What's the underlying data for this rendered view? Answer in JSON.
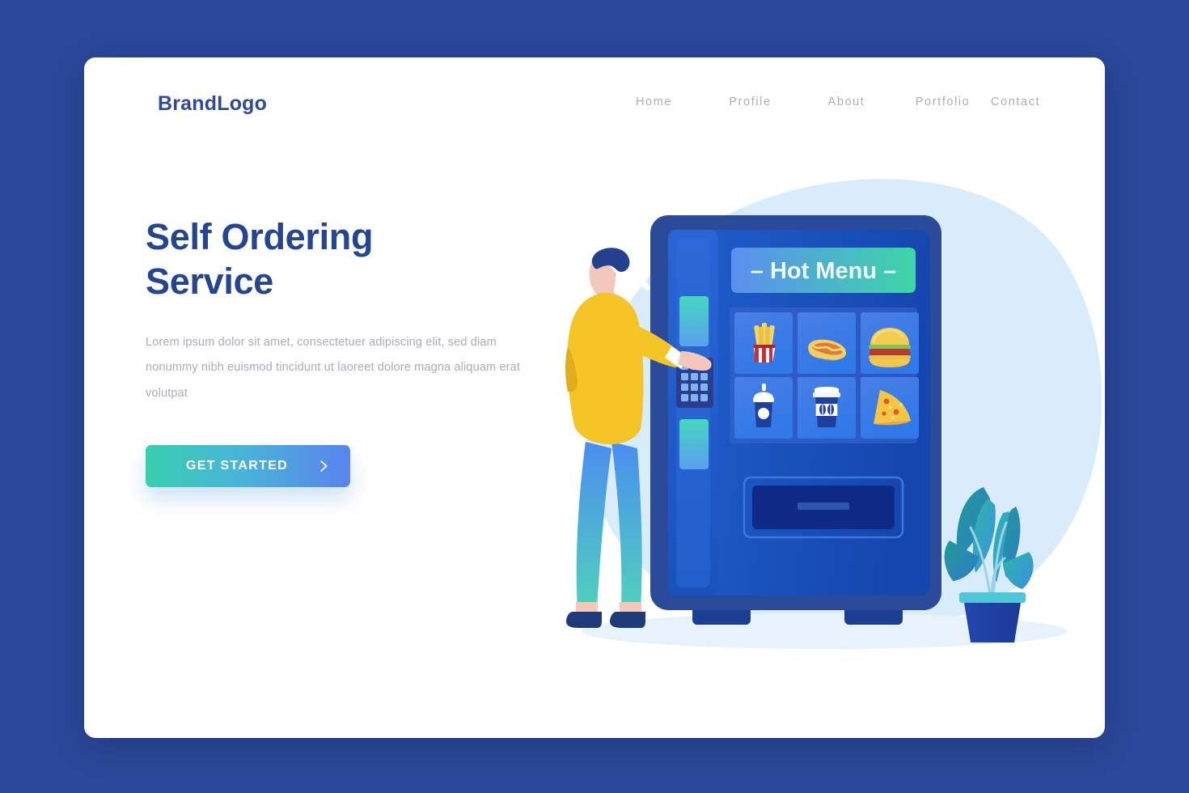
{
  "page": {
    "background_color": "#2a4799",
    "card_background": "#ffffff"
  },
  "header": {
    "brand": "BrandLogo",
    "brand_color": "#2c4a9a",
    "nav": [
      {
        "label": "Home"
      },
      {
        "label": "Profile"
      },
      {
        "label": "About"
      },
      {
        "label": "Portfolio"
      },
      {
        "label": "Contact"
      }
    ]
  },
  "hero": {
    "title_line1": "Self Ordering",
    "title_line2": "Service",
    "title_color": "#24458f",
    "description": "Lorem ipsum dolor sit amet, consectetuer adipiscing elit, sed diam nonummy nibh euismod tincidunt ut laoreet dolore magna aliquam erat volutpat",
    "cta_label": "GET STARTED",
    "cta_icon": "chevron-right-icon",
    "cta_gradient_from": "#38cfae",
    "cta_gradient_to": "#5a83ee"
  },
  "illustration": {
    "name": "self-ordering-vending-machine-illustration",
    "blob_color": "#d9ecfb",
    "cutlery_icon": "spoon-fork-crossed-icon",
    "vending_machine": {
      "body_color": "#1b56c4",
      "frame_color": "#2c4a9a",
      "screen_banner": {
        "label": "– Hot Menu –",
        "gradient_from": "#5b8ef0",
        "gradient_to": "#3dd6a8"
      },
      "menu_items": [
        {
          "name": "french-fries-icon",
          "label": "French Fries"
        },
        {
          "name": "hot-dog-icon",
          "label": "Hot Dog"
        },
        {
          "name": "burger-icon",
          "label": "Burger"
        },
        {
          "name": "smoothie-cup-icon",
          "label": "Smoothie"
        },
        {
          "name": "coffee-cup-icon",
          "label": "Coffee"
        },
        {
          "name": "pizza-slice-icon",
          "label": "Pizza Slice"
        }
      ],
      "keypad": {
        "name": "keypad",
        "rows": 4,
        "cols": 3
      },
      "dispenser_slot": {
        "name": "dispenser-slot"
      }
    },
    "person": {
      "name": "person-using-vending-machine",
      "hair_color": "#24418f",
      "shirt_color": "#f5c426",
      "pants_gradient_from": "#4a8df0",
      "pants_gradient_to": "#4fd1bd",
      "shoe_color": "#1e3a78"
    },
    "plant": {
      "name": "potted-plant",
      "pot_color": "#2347b0",
      "leaf_gradient_from": "#2bb7a8",
      "leaf_gradient_to": "#3c8fe0"
    }
  }
}
